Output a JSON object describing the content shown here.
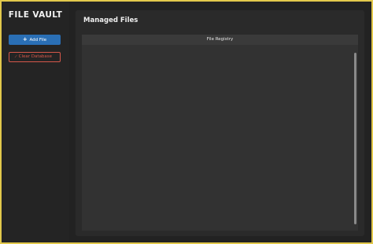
{
  "app": {
    "title": "FILE VAULT"
  },
  "sidebar": {
    "add_button": {
      "icon": "plus-icon",
      "glyph": "+",
      "label": "Add File"
    },
    "clear_button": {
      "icon": "trash-icon",
      "glyph": "̷",
      "label": "Clear Database"
    }
  },
  "main": {
    "title": "Managed Files",
    "registry": {
      "header": "File Registry"
    }
  },
  "colors": {
    "border_accent": "#e2c84c",
    "primary": "#2a6fb5",
    "danger": "#d5574a"
  }
}
